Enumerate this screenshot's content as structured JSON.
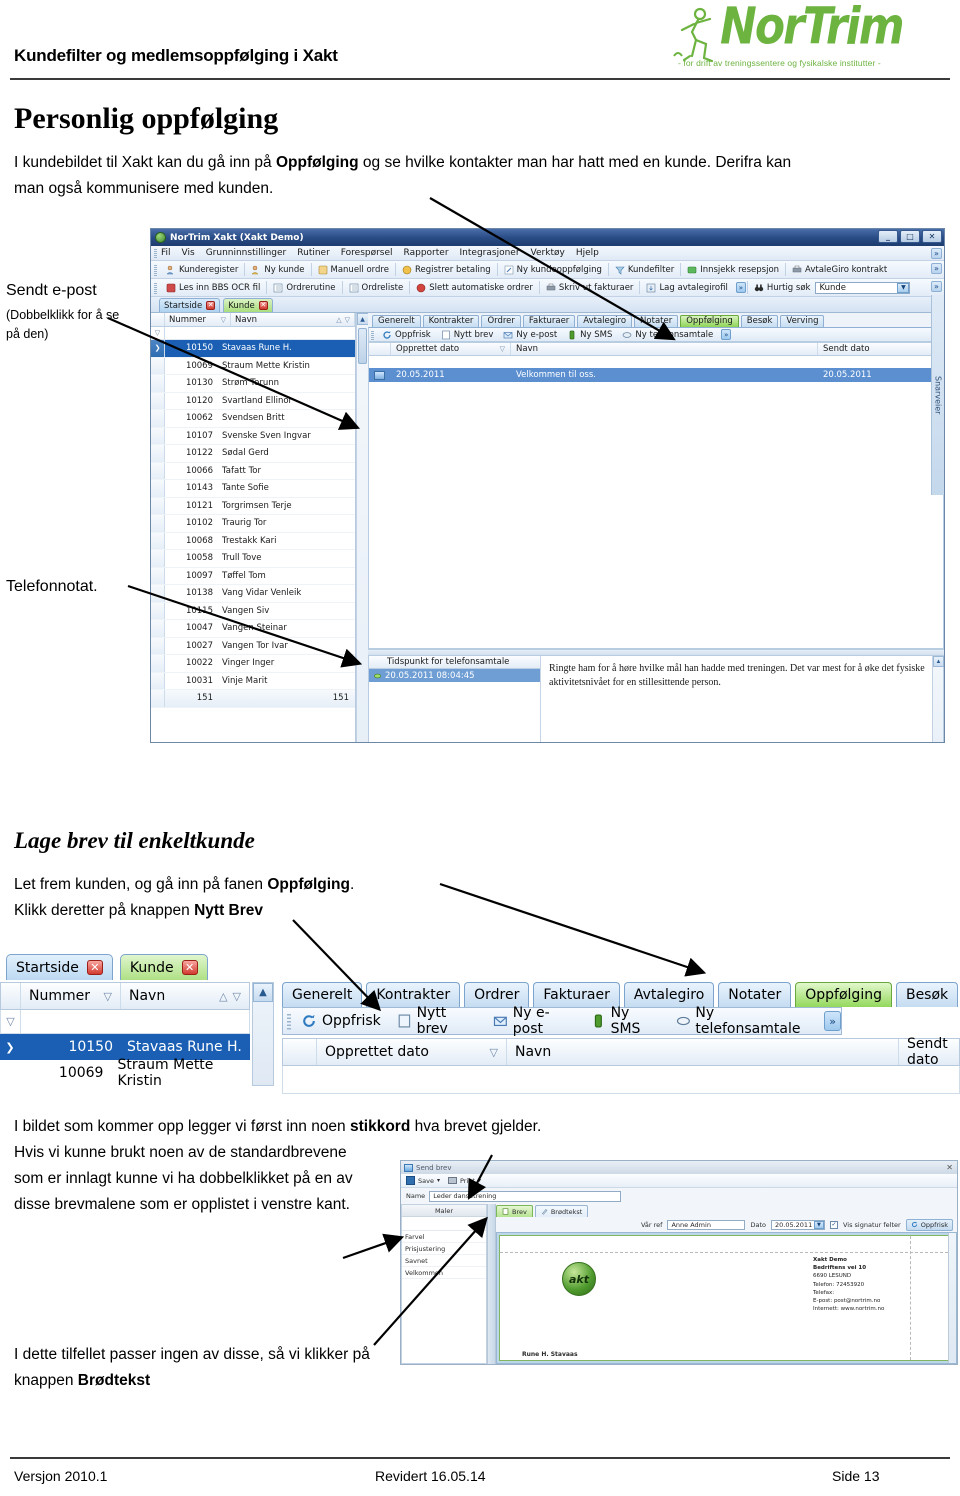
{
  "header": {
    "title": "Kundefilter og medlemsoppfølging  i Xakt",
    "logo_name": "NorTrim",
    "logo_tagline": "- for drift av treningssentere og fysikalske institutter -",
    "logo_color": "#6cb33f"
  },
  "section1": {
    "heading": "Personlig oppfølging",
    "para_before": "I kundebildet til Xakt kan du gå inn på ",
    "para_bold": "Oppfølging",
    "para_after": " og se hvilke kontakter man har hatt med en kunde. Derifra kan man også kommunisere med kunden."
  },
  "annotations": {
    "sendt_epost_title": "Sendt e-post",
    "sendt_epost_sub": "(Dobbelklikk for å se på den)",
    "telefonnotat": "Telefonnotat."
  },
  "section2": {
    "heading": "Lage brev til enkeltkunde",
    "line1_a": "Let frem kunden, og gå inn på fanen ",
    "line1_b": "Oppfølging",
    "line1_c": ".",
    "line2_a": "Klikk deretter på knappen  ",
    "line2_b": "Nytt Brev"
  },
  "section3": {
    "line1_a": "I bildet som kommer opp legger vi først inn noen ",
    "line1_b": "stikkord",
    "line1_c": " hva brevet gjelder.",
    "body": "Hvis vi kunne brukt noen av de standardbrevene som er innlagt kunne vi ha dobbelklikket på en av disse brevmalene som er opplistet i venstre kant.",
    "line3_a": "I dette tilfellet passer ingen av disse, så vi klikker på knappen  ",
    "line3_b": "Brødtekst"
  },
  "footer": {
    "version": "Versjon 2010.1",
    "revised": "Revidert 16.05.14",
    "page": "Side 13"
  },
  "app": {
    "window_title": "NorTrim Xakt (Xakt Demo)",
    "min_label": "_",
    "max_label": "□",
    "close_label": "✕",
    "menu": [
      "Fil",
      "Vis",
      "Grunninnstillinger",
      "Rutiner",
      "Forespørsel",
      "Rapporter",
      "Integrasjoner",
      "Verktøy",
      "Hjelp"
    ],
    "toolbar_row1": [
      "Kunderegister",
      "Ny kunde",
      "Manuell ordre",
      "Registrer betaling",
      "Ny kundeoppfølging",
      "Kundefilter",
      "Innsjekk resepsjon",
      "AvtaleGiro kontrakt"
    ],
    "toolbar_row2": [
      "Les inn BBS OCR fil",
      "Ordrerutine",
      "Ordreliste",
      "Slett automatiske ordrer",
      "Skriv ut fakturaer",
      "Lag avtalegirofil"
    ],
    "quick_search_label": "Hurtig søk",
    "quick_search_value": "Kunde",
    "doc_tabs": [
      {
        "label": "Startside",
        "state": "blue"
      },
      {
        "label": "Kunde",
        "state": "green"
      }
    ],
    "grid_headers": {
      "nummer": "Nummer",
      "navn": "Navn"
    },
    "customers": [
      {
        "nummer": "10150",
        "navn": "Stavaas Rune H.",
        "selected": true
      },
      {
        "nummer": "10069",
        "navn": "Straum Mette Kristin",
        "selected": false
      },
      {
        "nummer": "10130",
        "navn": "Strøm Torunn",
        "selected": false
      },
      {
        "nummer": "10120",
        "navn": "Svartland Ellinor",
        "selected": false
      },
      {
        "nummer": "10062",
        "navn": "Svendsen Britt",
        "selected": false
      },
      {
        "nummer": "10107",
        "navn": "Svenske Sven Ingvar",
        "selected": false
      },
      {
        "nummer": "10122",
        "navn": "Sødal Gerd",
        "selected": false
      },
      {
        "nummer": "10066",
        "navn": "Tafatt Tor",
        "selected": false
      },
      {
        "nummer": "10143",
        "navn": "Tante Sofie",
        "selected": false
      },
      {
        "nummer": "10121",
        "navn": "Torgrimsen Terje",
        "selected": false
      },
      {
        "nummer": "10102",
        "navn": "Traurig Tor",
        "selected": false
      },
      {
        "nummer": "10068",
        "navn": "Trestakk Kari",
        "selected": false
      },
      {
        "nummer": "10058",
        "navn": "Trull Tove",
        "selected": false
      },
      {
        "nummer": "10097",
        "navn": "Tøffel Tom",
        "selected": false
      },
      {
        "nummer": "10138",
        "navn": "Vang Vidar Venleik",
        "selected": false
      },
      {
        "nummer": "10115",
        "navn": "Vangen Siv",
        "selected": false
      },
      {
        "nummer": "10047",
        "navn": "Vangen Steinar",
        "selected": false
      },
      {
        "nummer": "10027",
        "navn": "Vangen Tor Ivar",
        "selected": false
      },
      {
        "nummer": "10022",
        "navn": "Vinger Inger",
        "selected": false
      },
      {
        "nummer": "10031",
        "navn": "Vinje Marit",
        "selected": false
      }
    ],
    "count_left": "151",
    "count_right": "151",
    "sub_tabs": [
      {
        "label": "Generelt",
        "active": false
      },
      {
        "label": "Kontrakter",
        "active": false
      },
      {
        "label": "Ordrer",
        "active": false
      },
      {
        "label": "Fakturaer",
        "active": false
      },
      {
        "label": "Avtalegiro",
        "active": false
      },
      {
        "label": "Notater",
        "active": false
      },
      {
        "label": "Oppfølging",
        "active": true
      },
      {
        "label": "Besøk",
        "active": false
      },
      {
        "label": "Verving",
        "active": false
      }
    ],
    "sub_toolbar": [
      "Oppfrisk",
      "Nytt brev",
      "Ny e-post",
      "Ny SMS",
      "Ny telefonsamtale"
    ],
    "followup_headers": {
      "dato": "Opprettet dato",
      "navn": "Navn",
      "sendt": "Sendt dato"
    },
    "followup_rows": [
      {
        "dato": "20.05.2011",
        "navn": "Velkommen til oss.",
        "sendt": "20.05.2011"
      }
    ],
    "phone_header": "Tidspunkt for telefonsamtale",
    "phone_row": "20.05.2011 08:04:45",
    "phone_note": "Ringte ham for å høre hvilke mål han hadde med treningen. Det var mest for å øke det fysiske aktivitetsnivået for en stillesittende person.",
    "sidebar_label": "Snarveier"
  },
  "letter_dialog": {
    "title": "Send brev",
    "close_label": "✕",
    "save_label": "Save",
    "print_label": "Print",
    "name_label": "Name",
    "name_value": "Leder dansetrening",
    "templates_header": "Maler",
    "templates": [
      "Farvel",
      "Prisjustering",
      "Savnet",
      "Velkommen"
    ],
    "tabs": [
      {
        "label": "Brev",
        "active": true
      },
      {
        "label": "Brødtekst",
        "active": false
      }
    ],
    "ref_label": "Vår ref",
    "ref_value": "Anne Admin",
    "date_label": "Dato",
    "date_value": "20.05.2011",
    "signature_checkbox": "Vis signatur felter",
    "refresh_label": "Oppfrisk",
    "company": {
      "name": "Xakt Demo",
      "street": "Bedriftens vei 10",
      "city": "6690 LESUND",
      "phone": "Telefon: 72453920",
      "fax": "Telefax:",
      "email": "E-post: post@nortrim.no",
      "web": "Internett: www.nortrim.no"
    },
    "recipient": "Rune H. Stavaas",
    "logo_text": "akt"
  }
}
